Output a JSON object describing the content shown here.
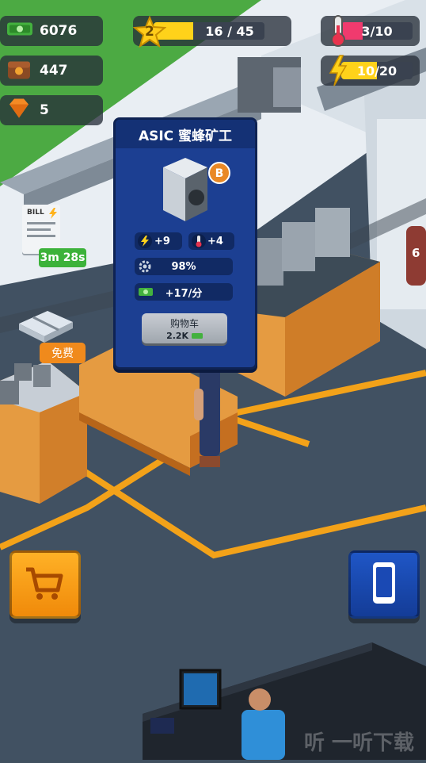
{
  "hud": {
    "cash": "6076",
    "bitcoin_wallet": "447",
    "gems": "5",
    "level": "2",
    "xp": "16 / 45",
    "xp_fraction": 0.36,
    "temperature": "3/10",
    "temperature_fraction": 0.3,
    "energy": "10/20",
    "energy_fraction": 0.5
  },
  "card": {
    "title": "ASIC 蜜蜂矿工",
    "power_stat": "+9",
    "heat_stat": "+4",
    "efficiency": "98%",
    "income": "+17/分",
    "buy_label": "购物车",
    "buy_price": "2.2K"
  },
  "world": {
    "bill_label": "BILL",
    "timer": "3m 28s",
    "free_label": "免费",
    "extinguisher_number": "6"
  },
  "watermark": "听 一听下载",
  "colors": {
    "accent_orange": "#ff9900",
    "accent_blue": "#1a49b4",
    "xp_yellow": "#ffd21a",
    "temp_pink": "#f03a6e",
    "energy_yellow": "#ffd21a"
  }
}
